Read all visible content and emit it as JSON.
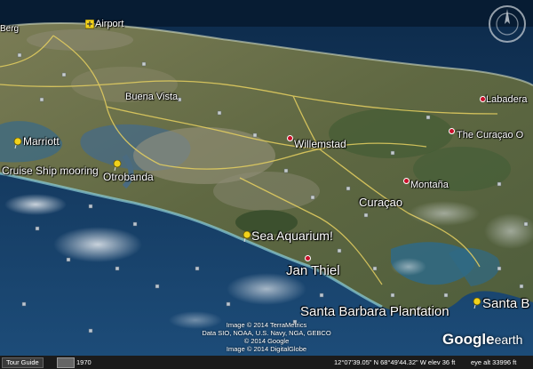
{
  "map": {
    "places": [
      {
        "name": "Airport",
        "kind": "airport-pin"
      },
      {
        "name": "Berg",
        "kind": "label"
      },
      {
        "name": "Buena Vista",
        "kind": "label"
      },
      {
        "name": "Labadera",
        "kind": "dot"
      },
      {
        "name": "Marriott",
        "kind": "yellow-pin"
      },
      {
        "name": "Cruise Ship mooring",
        "kind": "yellow-pin"
      },
      {
        "name": "Otrobanda",
        "kind": "yellow-pin"
      },
      {
        "name": "Willemstad",
        "kind": "dot"
      },
      {
        "name": "The Curaçao O",
        "kind": "dot"
      },
      {
        "name": "Montaña",
        "kind": "dot"
      },
      {
        "name": "Curaçao",
        "kind": "label"
      },
      {
        "name": "Sea Aquarium!",
        "kind": "yellow-pin"
      },
      {
        "name": "Jan Thiel",
        "kind": "dot"
      },
      {
        "name": "Santa Barbara Plantation",
        "kind": "label"
      },
      {
        "name": "Santa B",
        "kind": "yellow-pin"
      }
    ],
    "attribution": [
      "Image © 2014 TerraMetrics",
      "Data SIO, NOAA, U.S. Navy, NGA, GEBCO",
      "© 2014 Google",
      "Image © 2014 DigitalGlobe"
    ],
    "logo": {
      "brand": "Google",
      "suffix": "earth"
    }
  },
  "statusbar": {
    "tour_guide": "Tour Guide",
    "year": "1970",
    "coordinates": "12°07'39.05\" N   68°49'44.32\" W  elev   36 ft",
    "eye_alt": "eye alt  33996 ft"
  },
  "colors": {
    "ocean_deep": "#0d2a4a",
    "ocean_mid": "#1d4d7a",
    "land": "#6b7048",
    "pin": "#f2d21b",
    "dot": "#c9102a"
  }
}
